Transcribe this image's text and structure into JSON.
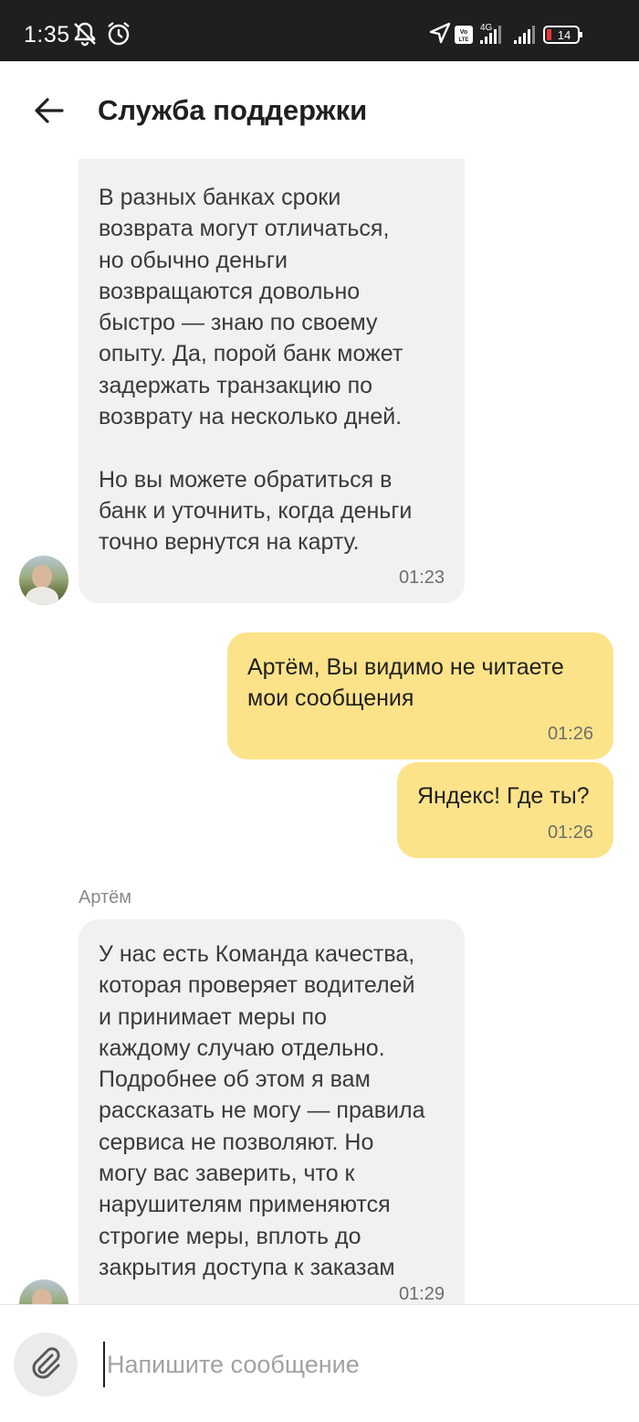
{
  "status_bar": {
    "time": "1:35",
    "network": "4G",
    "volte": "Vo LTE",
    "battery": "14",
    "icons": [
      "notifications-off-icon",
      "alarm-icon",
      "location-icon",
      "volte-icon",
      "signal-icon",
      "signal-icon",
      "battery-icon"
    ]
  },
  "header": {
    "back_icon": "arrow-left-icon",
    "title": "Служба поддержки"
  },
  "messages": [
    {
      "direction": "incoming",
      "text": "В разных банках сроки\nвозврата могут отличаться,\nно обычно деньги\nвозвращаются довольно\nбыстро — знаю по своему\nопыту. Да, порой банк может\nзадержать транзакцию по\nвозврату на несколько дней.\n\nНо вы можете обратиться в\nбанк и уточнить, когда деньги\nточно вернутся на карту.",
      "time": "01:23"
    },
    {
      "direction": "outgoing",
      "text": "Артём, Вы видимо не читаете\nмои сообщения",
      "time": "01:26"
    },
    {
      "direction": "outgoing",
      "text": "Яндекс! Где ты?",
      "time": "01:26"
    },
    {
      "direction": "incoming",
      "sender": "Артём",
      "text": "У нас есть Команда качества,\nкоторая проверяет водителей\nи принимает меры по\nкаждому случаю отдельно.\nПодробнее об этом я вам\nрассказать не могу — правила\nсервиса не позволяют. Но\nмогу вас заверить, что к\nнарушителям применяются\nстрогие меры, вплоть до\nзакрытия доступа к заказам",
      "time": "01:29"
    }
  ],
  "composer": {
    "attach_icon": "paperclip-icon",
    "placeholder": "Напишите сообщение"
  },
  "colors": {
    "incoming_bubble": "#f2f1ef",
    "outgoing_bubble": "#fce38a",
    "status_bar": "#1f1f1f",
    "battery_low": "#e53935"
  }
}
